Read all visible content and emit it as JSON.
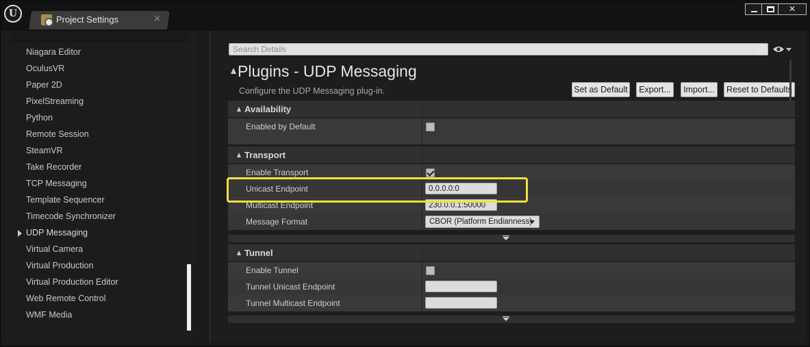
{
  "window": {
    "tab_title": "Project Settings",
    "tab_close": "×",
    "logo_text": "U",
    "close_label": "✕"
  },
  "sidebar": {
    "items": [
      {
        "label": "Niagara Editor"
      },
      {
        "label": "OculusVR"
      },
      {
        "label": "Paper 2D"
      },
      {
        "label": "PixelStreaming"
      },
      {
        "label": "Python"
      },
      {
        "label": "Remote Session"
      },
      {
        "label": "SteamVR"
      },
      {
        "label": "Take Recorder"
      },
      {
        "label": "TCP Messaging"
      },
      {
        "label": "Template Sequencer"
      },
      {
        "label": "Timecode Synchronizer"
      },
      {
        "label": "UDP Messaging"
      },
      {
        "label": "Virtual Camera"
      },
      {
        "label": "Virtual Production"
      },
      {
        "label": "Virtual Production Editor"
      },
      {
        "label": "Web Remote Control"
      },
      {
        "label": "WMF Media"
      }
    ],
    "active_item": "UDP Messaging"
  },
  "search": {
    "placeholder": "Search Details"
  },
  "header": {
    "title": "Plugins - UDP Messaging",
    "description": "Configure the UDP Messaging plug-in."
  },
  "actions": {
    "set_default": "Set as Default",
    "export": "Export...",
    "import": "Import...",
    "reset": "Reset to Defaults"
  },
  "sections": {
    "availability": {
      "label": "Availability",
      "enabled_by_default": {
        "label": "Enabled by Default",
        "checked": false
      }
    },
    "transport": {
      "label": "Transport",
      "enable_transport": {
        "label": "Enable Transport",
        "checked": true
      },
      "unicast_endpoint": {
        "label": "Unicast Endpoint",
        "value": "0.0.0.0:0"
      },
      "multicast_endpoint": {
        "label": "Multicast Endpoint",
        "value": "230.0.0.1:50000"
      },
      "message_format": {
        "label": "Message Format",
        "value": "CBOR (Platform Endianness)"
      }
    },
    "tunnel": {
      "label": "Tunnel",
      "enable_tunnel": {
        "label": "Enable Tunnel",
        "checked": false
      },
      "tunnel_unicast": {
        "label": "Tunnel Unicast Endpoint",
        "value": ""
      },
      "tunnel_multicast": {
        "label": "Tunnel Multicast Endpoint",
        "value": ""
      }
    }
  },
  "colors": {
    "highlight": "#f2e13c",
    "background": "#1d1d1d",
    "row": "#393939"
  }
}
